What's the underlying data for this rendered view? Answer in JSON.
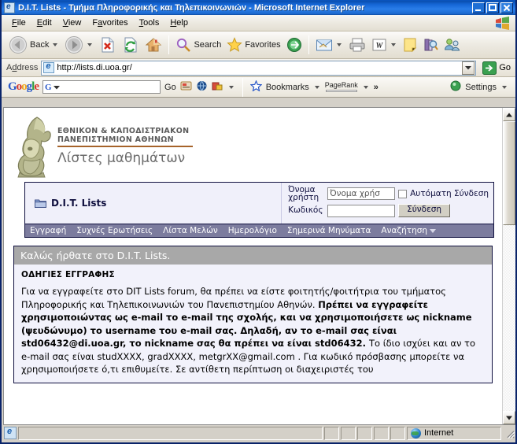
{
  "window": {
    "title": "D.I.T. Lists - Τμήμα Πληροφορικής και Τηλεπικοινωνιών - Microsoft Internet Explorer",
    "minimize": "_",
    "maximize": "□",
    "close": "✕"
  },
  "menu": [
    "File",
    "Edit",
    "View",
    "Favorites",
    "Tools",
    "Help"
  ],
  "toolbar": {
    "back": "Back",
    "search": "Search",
    "favorites": "Favorites"
  },
  "address": {
    "label": "Address",
    "url": "http://lists.di.uoa.gr/",
    "go": "Go"
  },
  "google": {
    "logo": "Google",
    "box_value": "",
    "go": "Go",
    "bookmarks": "Bookmarks",
    "pagerank": "PageRank",
    "more": "»",
    "settings": "Settings"
  },
  "site": {
    "university_line1": "ΕΘΝΙΚΟΝ & ΚΑΠΟΔΙΣΤΡΙΑΚΟΝ",
    "university_line2": "ΠΑΝΕΠΙΣΤΗΜΙΟΝ ΑΘΗΝΩΝ",
    "subtitle": "Λίστες μαθημάτων"
  },
  "forum": {
    "brand": "D.I.T. Lists",
    "username_label": "Όνομα χρήστη",
    "username_value": "Όνομα χρήσ",
    "password_label": "Κωδικός",
    "password_value": "",
    "autologin_label": "Αυτόματη Σύνδεση",
    "submit": "Σύνδεση",
    "nav": [
      "Εγγραφή",
      "Συχνές Ερωτήσεις",
      "Λίστα Μελών",
      "Ημερολόγιο",
      "Σημερινά Μηνύματα",
      "Αναζήτηση"
    ]
  },
  "panel": {
    "header": "Καλώς ήρθατε στο D.I.T. Lists.",
    "subheader": "ΟΔΗΓΙΕΣ ΕΓΓΡΑΦΗΣ",
    "para_1": "Για να εγγραφείτε στο DIT Lists forum, θα πρέπει να είστε φοιτητής/φοιτήτρια του τμήματος Πληροφορικής και Τηλεπικοινωνιών του Πανεπιστημίου Αθηνών. ",
    "para_bold": "Πρέπει να εγγραφείτε χρησιμοποιώντας ως e-mail το e-mail της σχολής, και να χρησιμοποιήσετε ως nickname (ψευδώνυμο) το username του e-mail σας. Δηλαδή, αν το e-mail σας είναι std06432@di.uoa.gr, το nickname σας θα πρέπει να είναι std06432. ",
    "para_2": "Το ίδιο ισχύει και αν το e-mail σας είναι studXXXX, gradXXXX, metgrXX@gmail.com . Για κωδικό πρόσβασης μπορείτε να χρησιμοποιήσετε ό,τι επιθυμείτε. Σε αντίθετη περίπτωση οι διαχειριστές του"
  },
  "status": {
    "message": "",
    "zone": "Internet"
  },
  "colors": {
    "titlebar": "#1566d6",
    "navbar": "#7c7c9e",
    "panel_header": "#a8a8a8",
    "forum_border": "#10103f",
    "rule": "#a6632a"
  }
}
